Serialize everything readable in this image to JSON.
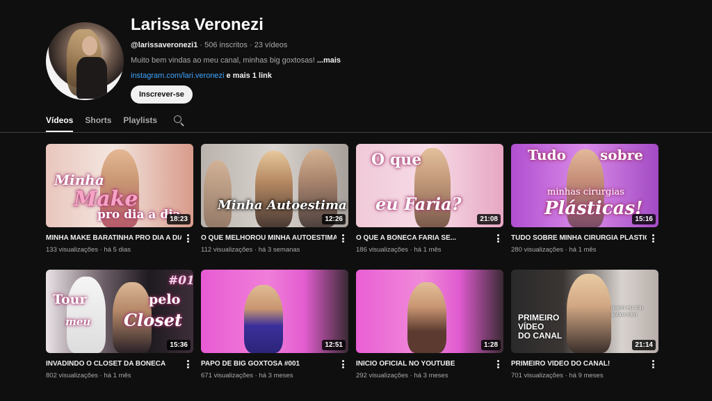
{
  "channel": {
    "name": "Larissa Veronezi",
    "handle": "@larissaveronezi1",
    "subscribers": "506 inscritos",
    "video_count": "23 vídeos",
    "separator": "·",
    "description": "Muito bem vindas ao meu canal, minhas big goxtosas! ",
    "description_more": "...mais",
    "link": "instagram.com/lari.veronezi",
    "more_links": " e mais 1 link",
    "subscribe_label": "Inscrever-se"
  },
  "tabs": [
    {
      "label": "Vídeos",
      "active": true
    },
    {
      "label": "Shorts",
      "active": false
    },
    {
      "label": "Playlists",
      "active": false
    }
  ],
  "videos": [
    {
      "title": "MINHA MAKE BARATINHA PRO DIA A DIA",
      "views": "133 visualizações",
      "age": "há 5 dias",
      "duration": "18:23",
      "overlay": [
        "Minha",
        "Make",
        "pro dia a dia"
      ],
      "theme": "peach"
    },
    {
      "title": "O QUE MELHOROU MINHA AUTOESTIMA",
      "views": "112 visualizações",
      "age": "há 3 semanas",
      "duration": "12:26",
      "overlay": [
        "Minha Autoestima"
      ],
      "theme": "grey"
    },
    {
      "title": "O QUE A BONECA FARIA SE...",
      "views": "186 visualizações",
      "age": "há 1 mês",
      "duration": "21:08",
      "overlay": [
        "O que",
        "eu Faria?"
      ],
      "theme": "pink"
    },
    {
      "title": "TUDO SOBRE MINHA CIRURGIA PLÁSTICA",
      "views": "280 visualizações",
      "age": "há 1 mês",
      "duration": "15:16",
      "overlay": [
        "Tudo",
        "sobre",
        "minhas cirurgias",
        "Plásticas!"
      ],
      "theme": "violet"
    },
    {
      "title": "INVADINDO O CLOSET DA BONECA",
      "views": "802 visualizações",
      "age": "há 1 mês",
      "duration": "15:36",
      "overlay": [
        "Tour",
        "pelo",
        "meu",
        "Closet",
        "#01"
      ],
      "theme": "closet"
    },
    {
      "title": "PAPO DE BIG GOXTOSA #001",
      "views": "671 visualizações",
      "age": "há 3 meses",
      "duration": "12:51",
      "overlay": [],
      "theme": "magenta"
    },
    {
      "title": "INÍCIO OFICIAL NO YOUTUBE",
      "views": "292 visualizações",
      "age": "há 3 meses",
      "duration": "1:28",
      "overlay": [],
      "theme": "magenta2"
    },
    {
      "title": "PRIMEIRO VÍDEO DO CANAL!",
      "views": "701 visualizações",
      "age": "há 9 meses",
      "duration": "21:14",
      "overlay": [
        "PRIMEIRO",
        "VÍDEO",
        "DO CANAL",
        "quem eu sou",
        "sobre mim"
      ],
      "theme": "dark"
    }
  ],
  "stat_separator": " · ",
  "colors": {
    "background": "#0f0f0f",
    "link": "#3ea6ff",
    "divider": "#3f3f3f"
  },
  "icons": {
    "search_tab": "search-icon",
    "menu": "kebab-menu-icon"
  }
}
